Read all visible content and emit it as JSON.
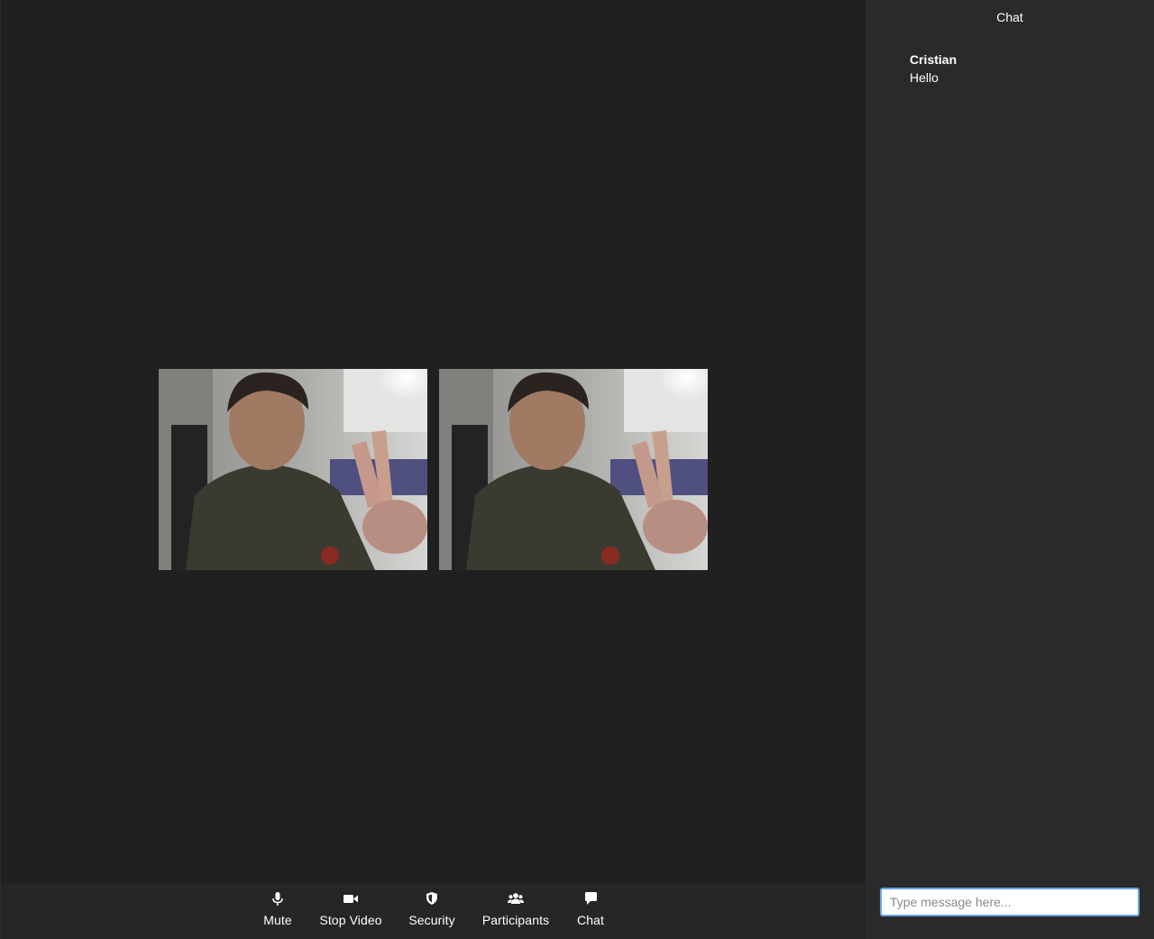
{
  "toolbar": {
    "buttons": [
      {
        "label": "Mute",
        "icon": "microphone-icon"
      },
      {
        "label": "Stop Video",
        "icon": "video-camera-icon"
      },
      {
        "label": "Security",
        "icon": "shield-icon"
      },
      {
        "label": "Participants",
        "icon": "participants-icon"
      },
      {
        "label": "Chat",
        "icon": "chat-bubble-icon"
      }
    ]
  },
  "chat": {
    "title": "Chat",
    "messages": [
      {
        "sender": "Cristian",
        "text": "Hello"
      }
    ],
    "input_placeholder": "Type message here..."
  },
  "colors": {
    "stage_background": "#202020",
    "chat_background": "#2a2a2a",
    "toolbar_background": "#262626",
    "input_focus_border": "#6aa0e8"
  }
}
